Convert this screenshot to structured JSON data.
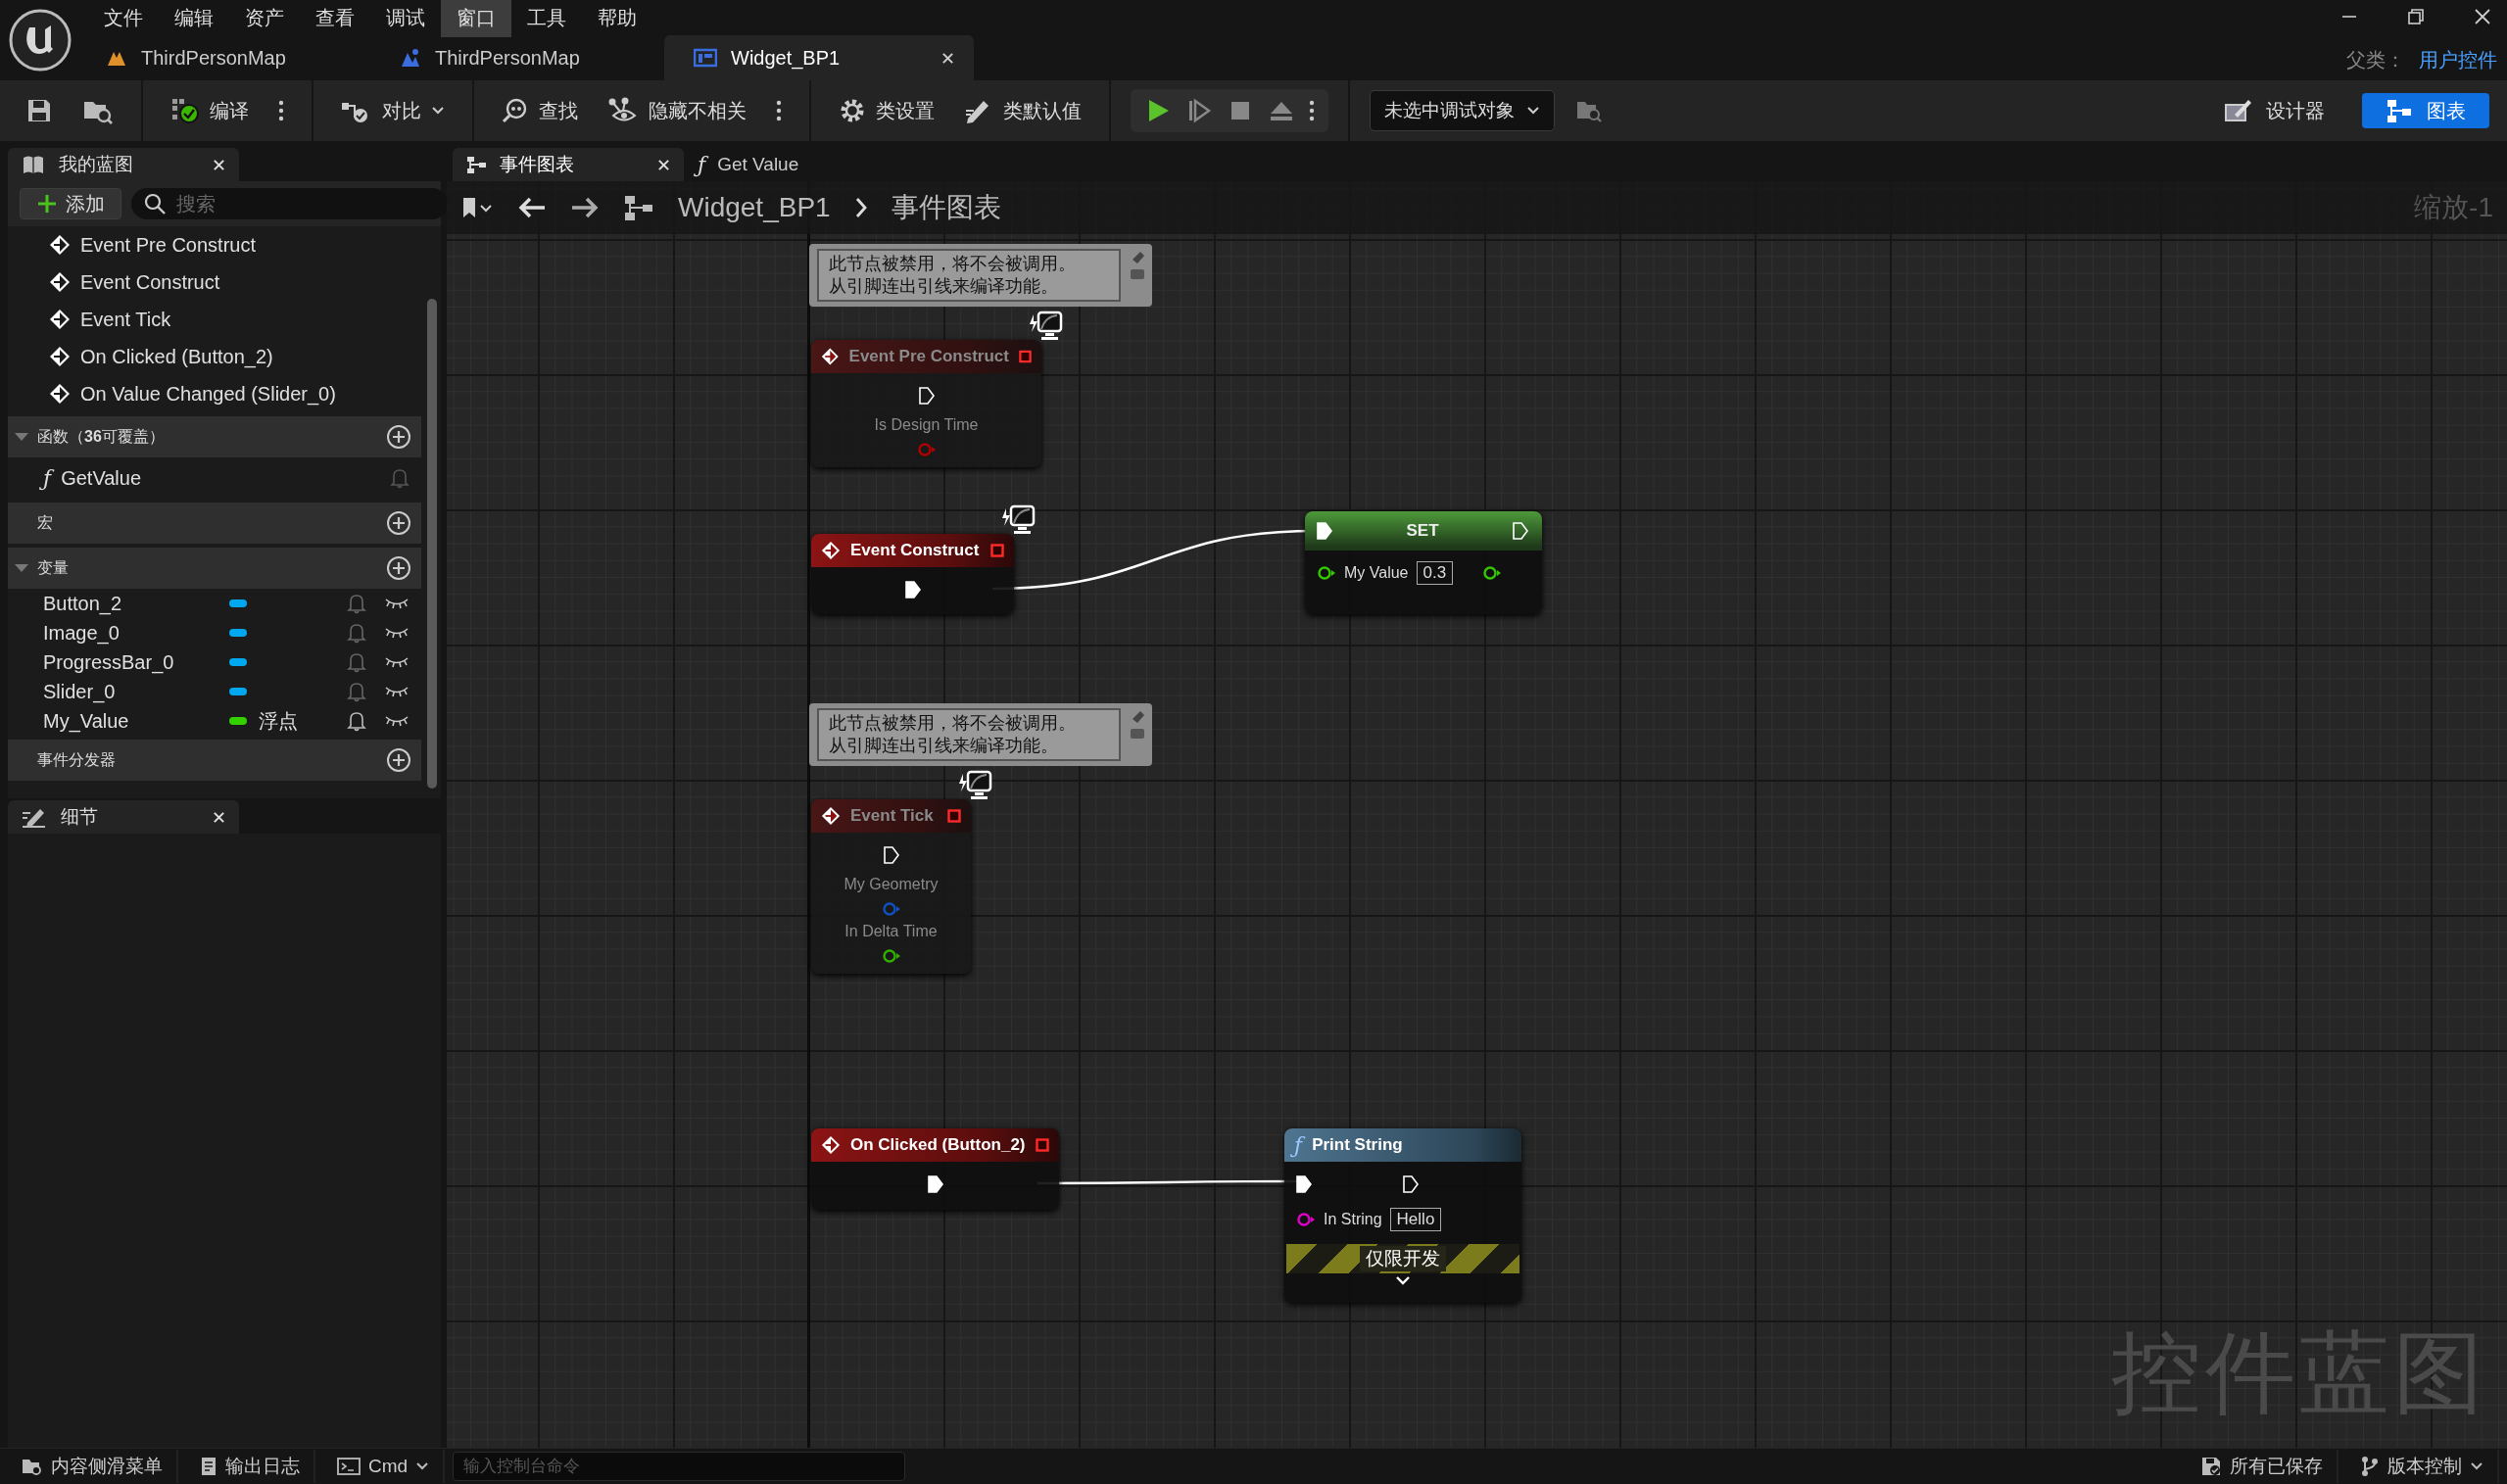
{
  "menu": [
    {
      "label": "文件",
      "selected": false
    },
    {
      "label": "编辑",
      "selected": false
    },
    {
      "label": "资产",
      "selected": false
    },
    {
      "label": "查看",
      "selected": false
    },
    {
      "label": "调试",
      "selected": false
    },
    {
      "label": "窗口",
      "selected": true
    },
    {
      "label": "工具",
      "selected": false
    },
    {
      "label": "帮助",
      "selected": false
    }
  ],
  "document_tabs": [
    {
      "label": "ThirdPersonMap",
      "selected": false
    },
    {
      "label": "ThirdPersonMap",
      "selected": false
    },
    {
      "label": "Widget_BP1",
      "selected": true
    }
  ],
  "parent_class": {
    "label": "父类：",
    "value": "用户控件"
  },
  "toolbar": {
    "compile": "编译",
    "diff": "对比",
    "find": "查找",
    "hide_unrelated": "隐藏不相关",
    "class_settings": "类设置",
    "class_defaults": "类默认值",
    "debug_object": "未选中调试对象",
    "modes": [
      {
        "label": "设计器",
        "selected": false
      },
      {
        "label": "图表",
        "selected": true
      }
    ]
  },
  "my_blueprint": {
    "title": "我的蓝图",
    "add": "添加",
    "search_placeholder": "搜索",
    "events": [
      "Event Pre Construct",
      "Event Construct",
      "Event Tick",
      "On Clicked (Button_2)",
      "On Value Changed (Slider_0)"
    ],
    "sections": [
      {
        "title": "函数（**36**可覆盖）",
        "expanded": true,
        "functions": [
          {
            "icon": "ƒ",
            "name": "GetValue"
          }
        ]
      },
      {
        "title": "宏"
      },
      {
        "title": "变量",
        "expanded": true,
        "variables": [
          {
            "name": "Button_2",
            "color": "#00a8f0"
          },
          {
            "name": "Image_0",
            "color": "#00a8f0"
          },
          {
            "name": "ProgressBar_0",
            "color": "#00a8f0"
          },
          {
            "name": "Slider_0",
            "color": "#00a8f0"
          },
          {
            "name": "My_Value",
            "color": "#34d100",
            "type": "浮点"
          }
        ]
      },
      {
        "title": "事件分发器"
      }
    ]
  },
  "details": {
    "title": "细节"
  },
  "graph_tabs": [
    {
      "label": "事件图表",
      "selected": true
    },
    {
      "icon": "ƒ",
      "label": "Get Value",
      "selected": false
    }
  ],
  "breadcrumb": [
    "Widget_BP1",
    "事件图表"
  ],
  "zoom": "缩放-1",
  "watermark": "控件蓝图",
  "nodes": [
    {
      "kind": "event",
      "title": "Event Pre Construct",
      "disabled": true,
      "client_icon": true,
      "comment": [
        "此节点被禁用，将不会被调用。",
        "从引脚连出引线来编译功能。"
      ],
      "rows": [
        {
          "output": {
            "kind": "exec",
            "connected": false
          }
        },
        {
          "output": {
            "kind": "data",
            "label": "Is Design Time",
            "color": "#b00000",
            "connected": false
          }
        }
      ]
    },
    {
      "kind": "event",
      "title": "Event Construct",
      "disabled": false,
      "client_icon": true,
      "rows": [
        {
          "output": {
            "kind": "exec",
            "connected": true
          }
        }
      ]
    },
    {
      "kind": "set",
      "title": "SET",
      "disabled": false,
      "rows": [
        {
          "input": {
            "kind": "exec",
            "connected": true
          },
          "output": {
            "kind": "exec",
            "connected": false
          }
        },
        {
          "input": {
            "kind": "data",
            "label": "My Value",
            "value": "0.3",
            "color": "#34c800",
            "connected": false
          },
          "output": {
            "kind": "data",
            "color": "#34c800",
            "connected": false
          }
        }
      ]
    },
    {
      "kind": "event",
      "title": "Event Tick",
      "disabled": true,
      "client_icon": true,
      "comment": [
        "此节点被禁用，将不会被调用。",
        "从引脚连出引线来编译功能。"
      ],
      "rows": [
        {
          "output": {
            "kind": "exec",
            "connected": false
          }
        },
        {
          "output": {
            "kind": "data",
            "label": "My Geometry",
            "color": "#1050c0",
            "connected": false
          }
        },
        {
          "output": {
            "kind": "data",
            "label": "In Delta Time",
            "color": "#30b000",
            "connected": false
          }
        }
      ]
    },
    {
      "kind": "event",
      "title": "On Clicked (Button_2)",
      "disabled": false,
      "client_icon": false,
      "rows": [
        {
          "output": {
            "kind": "exec",
            "connected": true
          }
        }
      ]
    },
    {
      "kind": "function",
      "icon": "ƒ",
      "title": "Print String",
      "disabled": false,
      "footer": "仅限开发",
      "rows": [
        {
          "input": {
            "kind": "exec",
            "connected": true
          },
          "output": {
            "kind": "exec",
            "connected": false
          }
        },
        {
          "input": {
            "kind": "data",
            "label": "In String",
            "value": "Hello",
            "color": "#e000c8",
            "connected": false
          }
        }
      ]
    }
  ],
  "status_bar": {
    "content_drawer": "内容侧滑菜单",
    "output_log": "输出日志",
    "cmd": "Cmd",
    "console_placeholder": "输入控制台命令",
    "save_status": "所有已保存",
    "source_control": "版本控制"
  }
}
